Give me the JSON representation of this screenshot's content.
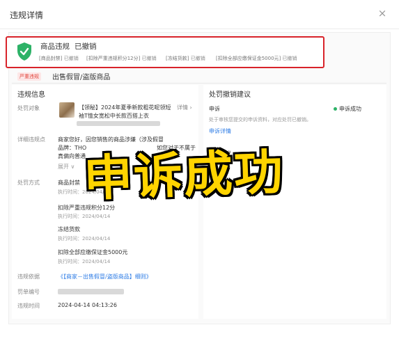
{
  "dialog": {
    "title": "违规详情",
    "close_glyph": "×"
  },
  "banner": {
    "title": "商品违规",
    "status": "已撤销",
    "tags": [
      {
        "label": "[商品封禁]",
        "status": "已撤销"
      },
      {
        "label": "[扣除严重违规积分12分]",
        "status": "已撤销"
      },
      {
        "label": "[冻结货款]",
        "status": "已撤销"
      },
      {
        "label": "[扣除全部应缴保证金5000元]",
        "status": "已撤销"
      }
    ],
    "accent_color": "#2db267",
    "border_color": "#d8232a"
  },
  "category": {
    "badge": "严重违规",
    "title": "出售假冒/盗版商品"
  },
  "violation_info": {
    "section_title": "违规信息",
    "object_label": "处罚对象",
    "object_text_line1": "【领秘】2024年夏季新款粗花呢领短",
    "object_text_line2": "袖T恤女宽松中长款百搭上衣",
    "object_detail_link": "详情 ›",
    "description_label": "详细违规点",
    "description_line1": "商家您好，因您销售的商品涉嫌（涉及假冒",
    "description_line2": "品牌：THO",
    "description_line3": "如您对于不属于",
    "description_line4": "真偏向普通",
    "expand_link": "展开 ∨",
    "method_label": "处罚方式",
    "methods": [
      {
        "name": "商品封禁",
        "time_label": "执行时间：",
        "time": "2024/04/14"
      },
      {
        "name": "扣除严重违规积分12分",
        "time_label": "执行时间：",
        "time": "2024/04/14"
      },
      {
        "name": "冻结货款",
        "time_label": "执行时间：",
        "time": "2024/04/14"
      },
      {
        "name": "扣除全部应缴保证金5000元",
        "time_label": "执行时间：",
        "time": "2024/04/14"
      }
    ],
    "basis_label": "违规依据",
    "basis_link": "《【商家－出售假冒/盗版商品】细则》",
    "ticket_label": "罚单编号",
    "time_label": "违规时间",
    "time_value": "2024-04-14 04:13:26"
  },
  "suggestion": {
    "section_title": "处罚撤销建议",
    "appeal_label": "申诉",
    "appeal_status": "申诉成功",
    "appeal_desc": "处于审核您提交的申诉资料，对应处罚已撤销。",
    "appeal_link": "申诉详情",
    "compliance_title": "合规建议"
  },
  "overlay": {
    "text": "申诉成功",
    "color": "#ffd400"
  }
}
